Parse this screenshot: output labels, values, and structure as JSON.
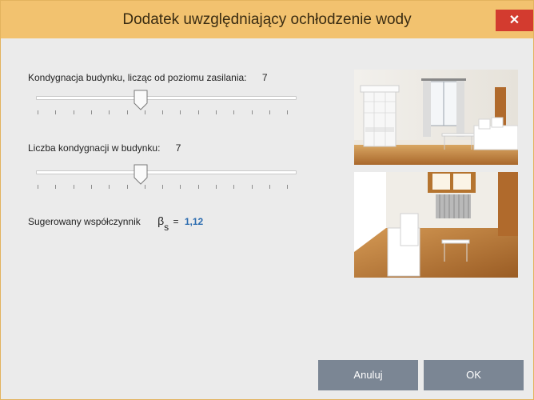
{
  "window": {
    "title": "Dodatek uwzględniający ochłodzenie wody",
    "close_label": "✕"
  },
  "floor_slider": {
    "label": "Kondygnacja budynku, licząc od poziomu zasilania:",
    "value": "7"
  },
  "floors_count_slider": {
    "label": "Liczba kondygnacji w budynku:",
    "value": "7"
  },
  "coefficient": {
    "label": "Sugerowany współczynnik",
    "symbol": "β",
    "subscript": "s",
    "equals": "=",
    "value": "1,12"
  },
  "buttons": {
    "cancel": "Anuluj",
    "ok": "OK"
  },
  "colors": {
    "titlebar": "#f2c26f",
    "close": "#d33b2f",
    "button": "#7b8694",
    "accent_value": "#2b6cb0"
  }
}
